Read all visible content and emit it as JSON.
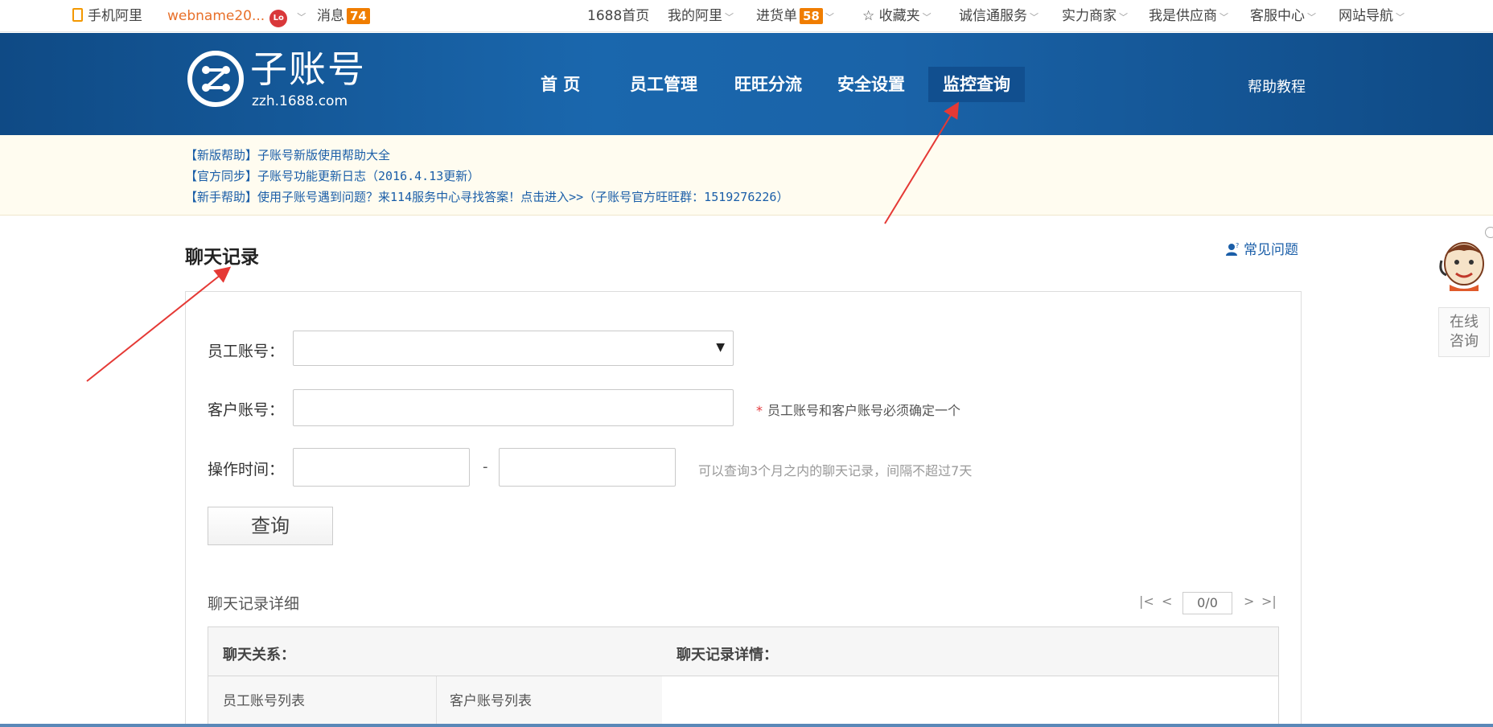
{
  "topbar": {
    "mobile": "手机阿里",
    "username": "webname20...",
    "level_badge": "Lo",
    "messages_label": "消息",
    "messages_count": "74",
    "home_1688": "1688首页",
    "my_ali": "我的阿里",
    "purchase_label": "进货单",
    "purchase_count": "58",
    "favorites": "☆ 收藏夹",
    "chengxin": "诚信通服务",
    "strong_merchant": "实力商家",
    "supplier": "我是供应商",
    "service_center": "客服中心",
    "site_nav": "网站导航"
  },
  "header": {
    "logo_main": "子账号",
    "logo_sub": "zzh.1688.com",
    "nav": [
      "首 页",
      "员工管理",
      "旺旺分流",
      "安全设置",
      "监控查询"
    ],
    "active_nav": "监控查询",
    "help": "帮助教程"
  },
  "notice": {
    "lines": [
      "【新版帮助】子账号新版使用帮助大全",
      "【官方同步】子账号功能更新日志（2016.4.13更新）",
      "【新手帮助】使用子账号遇到问题？来114服务中心寻找答案！点击进入>>（子账号官方旺旺群：1519276226）"
    ]
  },
  "page": {
    "title": "聊天记录",
    "faq": "常见问题"
  },
  "form": {
    "employee_label": "员工账号：",
    "employee_value": "",
    "customer_label": "客户账号：",
    "customer_value": "",
    "required_star": "*",
    "required_note": "员工账号和客户账号必须确定一个",
    "time_label": "操作时间：",
    "time_start": "",
    "time_end": "",
    "time_separator": "-",
    "time_hint": "可以查询3个月之内的聊天记录，间隔不超过7天",
    "query_button": "查询"
  },
  "detail": {
    "title": "聊天记录详细",
    "pager": {
      "first": "|<",
      "prev": "<",
      "page": "0/0",
      "next": ">",
      "last": ">|"
    },
    "table": {
      "headers": [
        "聊天关系：",
        "聊天记录详情："
      ],
      "sub_headers": [
        "员工账号列表",
        "客户账号列表"
      ]
    }
  },
  "consult": {
    "line1": "在线",
    "line2": "咨询"
  },
  "colors": {
    "header_blue": "#1a63a8",
    "link_blue": "#1a5ea8",
    "badge_orange": "#f07d00",
    "required_red": "#e4393c",
    "annotation_red": "#e53935"
  }
}
